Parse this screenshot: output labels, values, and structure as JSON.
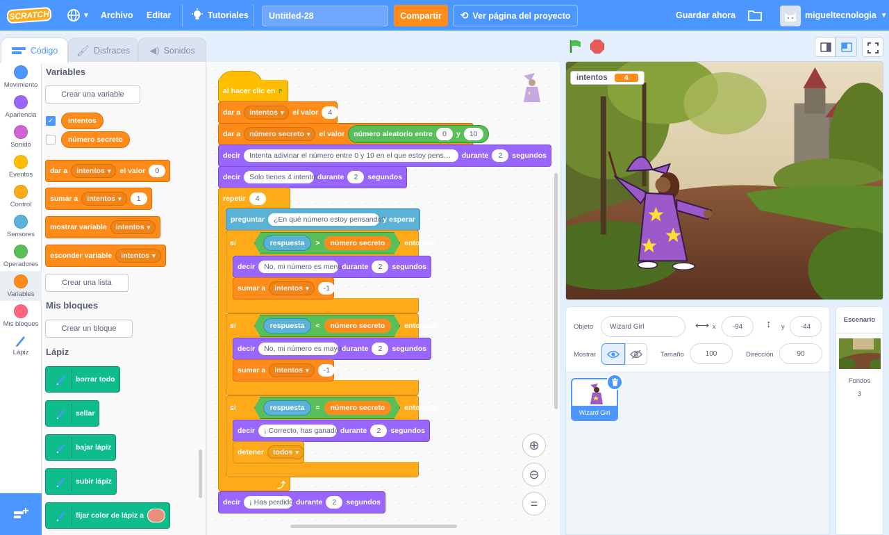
{
  "menubar": {
    "logo": "SCRATCH",
    "file": "Archivo",
    "edit": "Editar",
    "tutorials": "Tutoriales",
    "project_title": "Untitled-28",
    "share": "Compartir",
    "see_project_page": "Ver página del proyecto",
    "save_now": "Guardar ahora",
    "username": "migueltecnologia"
  },
  "tabs": {
    "code": "Código",
    "costumes": "Disfraces",
    "sounds": "Sonidos"
  },
  "categories": [
    {
      "label": "Movimiento",
      "color": "#4c97ff"
    },
    {
      "label": "Apariencia",
      "color": "#9966ff"
    },
    {
      "label": "Sonido",
      "color": "#cf63cf"
    },
    {
      "label": "Eventos",
      "color": "#ffbf00"
    },
    {
      "label": "Control",
      "color": "#ffab19"
    },
    {
      "label": "Sensores",
      "color": "#5cb1d6"
    },
    {
      "label": "Operadores",
      "color": "#59c059"
    },
    {
      "label": "Variables",
      "color": "#ff8c1a"
    },
    {
      "label": "Mis bloques",
      "color": "#ff6680"
    },
    {
      "label": "Lápiz",
      "color": "#0fbd8c"
    }
  ],
  "palette": {
    "variables_heading": "Variables",
    "create_variable": "Crear una variable",
    "var1": "intentos",
    "var2": "número secreto",
    "set_to": "dar a",
    "set_var": "intentos",
    "set_value_label": "el valor",
    "set_value": "0",
    "change_by": "sumar a",
    "change_var": "intentos",
    "change_value": "1",
    "show_var": "mostrar variable",
    "show_var_name": "intentos",
    "hide_var": "esconder variable",
    "hide_var_name": "intentos",
    "create_list": "Crear una lista",
    "myblocks_heading": "Mis bloques",
    "create_block": "Crear un bloque",
    "pen_heading": "Lápiz",
    "pen_clear": "borrar todo",
    "pen_stamp": "sellar",
    "pen_down": "bajar lápiz",
    "pen_up": "subir lápiz",
    "pen_color": "fijar color de lápiz a",
    "pen_color_value": "#e8907a"
  },
  "script": {
    "hat": "al hacer clic en",
    "set1_label": "dar a",
    "set1_var": "intentos",
    "set1_mid": "el valor",
    "set1_val": "4",
    "set2_label": "dar a",
    "set2_var": "número secreto",
    "set2_mid": "el valor",
    "random_label": "número aleatorio entre",
    "random_from": "0",
    "random_and": "y",
    "random_to": "10",
    "say1": "decir",
    "say1_text": "Intenta adivinar el número entre 0 y 10 en el que estoy pensando...",
    "say1_for": "durante",
    "say1_secs": "2",
    "say1_unit": "segundos",
    "say2": "decir",
    "say2_text": "Solo tienes 4 intentos",
    "say2_for": "durante",
    "say2_secs": "2",
    "say2_unit": "segundos",
    "repeat": "repetir",
    "repeat_n": "4",
    "ask": "preguntar",
    "ask_text": "¿En qué número estoy pensando?",
    "ask_wait": "y esperar",
    "if1": "si",
    "if1_a": "respuesta",
    "if1_op": ">",
    "if1_b": "número secreto",
    "if1_then": "entonces",
    "say3": "decir",
    "say3_text": "No, mi número es menor",
    "say3_for": "durante",
    "say3_secs": "2",
    "say3_unit": "segundos",
    "change1": "sumar a",
    "change1_var": "intentos",
    "change1_val": "-1",
    "if2": "si",
    "if2_a": "respuesta",
    "if2_op": "<",
    "if2_b": "número secreto",
    "if2_then": "entonces",
    "say4": "decir",
    "say4_text": "No, mi número es mayor",
    "say4_for": "durante",
    "say4_secs": "2",
    "say4_unit": "segundos",
    "change2": "sumar a",
    "change2_var": "intentos",
    "change2_val": "-1",
    "if3": "si",
    "if3_a": "respuesta",
    "if3_op": "=",
    "if3_b": "número secreto",
    "if3_then": "entonces",
    "say5": "decir",
    "say5_text": "¡ Correcto, has ganado !",
    "say5_for": "durante",
    "say5_secs": "2",
    "say5_unit": "segundos",
    "stop": "detener",
    "stop_opt": "todos",
    "say6": "decir",
    "say6_text": "¡ Has perdido !",
    "say6_for": "durante",
    "say6_secs": "2",
    "say6_unit": "segundos"
  },
  "stage": {
    "monitor_label": "intentos",
    "monitor_value": "4"
  },
  "sprite_info": {
    "sprite_label": "Objeto",
    "sprite_name": "Wizard Girl",
    "x_label": "x",
    "x": "-94",
    "y_label": "y",
    "y": "-44",
    "show_label": "Mostrar",
    "size_label": "Tamaño",
    "size": "100",
    "direction_label": "Dirección",
    "direction": "90"
  },
  "sprites": [
    {
      "name": "Wizard Girl"
    }
  ],
  "stage_panel": {
    "title": "Escenario",
    "backdrops_label": "Fondos",
    "backdrops_count": "3"
  },
  "colors": {
    "menu": "#4c97ff",
    "variables": "#ff8c1a",
    "looks": "#9966ff",
    "control": "#ffab19",
    "operators": "#59c059",
    "sensing": "#5cb1d6",
    "pen": "#0fbd8c",
    "events": "#ffbf00"
  }
}
